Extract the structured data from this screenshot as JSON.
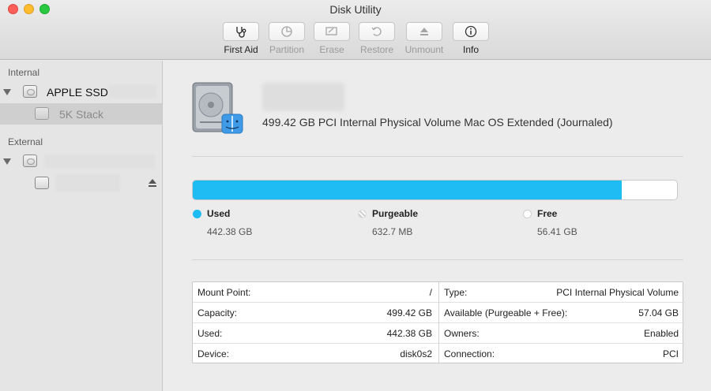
{
  "window": {
    "title": "Disk Utility"
  },
  "toolbar": {
    "items": [
      {
        "label": "First Aid",
        "icon": "stethoscope-icon",
        "enabled": true
      },
      {
        "label": "Partition",
        "icon": "pie-icon",
        "enabled": false
      },
      {
        "label": "Erase",
        "icon": "eraser-icon",
        "enabled": false
      },
      {
        "label": "Restore",
        "icon": "restore-icon",
        "enabled": false
      },
      {
        "label": "Unmount",
        "icon": "eject-icon",
        "enabled": false
      },
      {
        "label": "Info",
        "icon": "info-icon",
        "enabled": true
      }
    ]
  },
  "sidebar": {
    "internal_header": "Internal",
    "internal_disk": "APPLE SSD",
    "internal_volume": "5K Stack",
    "external_header": "External"
  },
  "main": {
    "volume_description": "499.42 GB PCI Internal Physical Volume Mac OS Extended (Journaled)",
    "usage": {
      "used_fraction": 0.886,
      "legend": [
        {
          "name": "Used",
          "value": "442.38 GB",
          "color": "#1ebcf2"
        },
        {
          "name": "Purgeable",
          "value": "632.7 MB",
          "color": "#e8e8e8"
        },
        {
          "name": "Free",
          "value": "56.41 GB",
          "color": "#ffffff"
        }
      ]
    },
    "info_left": [
      {
        "key": "Mount Point:",
        "value": "/"
      },
      {
        "key": "Capacity:",
        "value": "499.42 GB"
      },
      {
        "key": "Used:",
        "value": "442.38 GB"
      },
      {
        "key": "Device:",
        "value": "disk0s2"
      }
    ],
    "info_right": [
      {
        "key": "Type:",
        "value": "PCI Internal Physical Volume"
      },
      {
        "key": "Available (Purgeable + Free):",
        "value": "57.04 GB"
      },
      {
        "key": "Owners:",
        "value": "Enabled"
      },
      {
        "key": "Connection:",
        "value": "PCI"
      }
    ]
  }
}
